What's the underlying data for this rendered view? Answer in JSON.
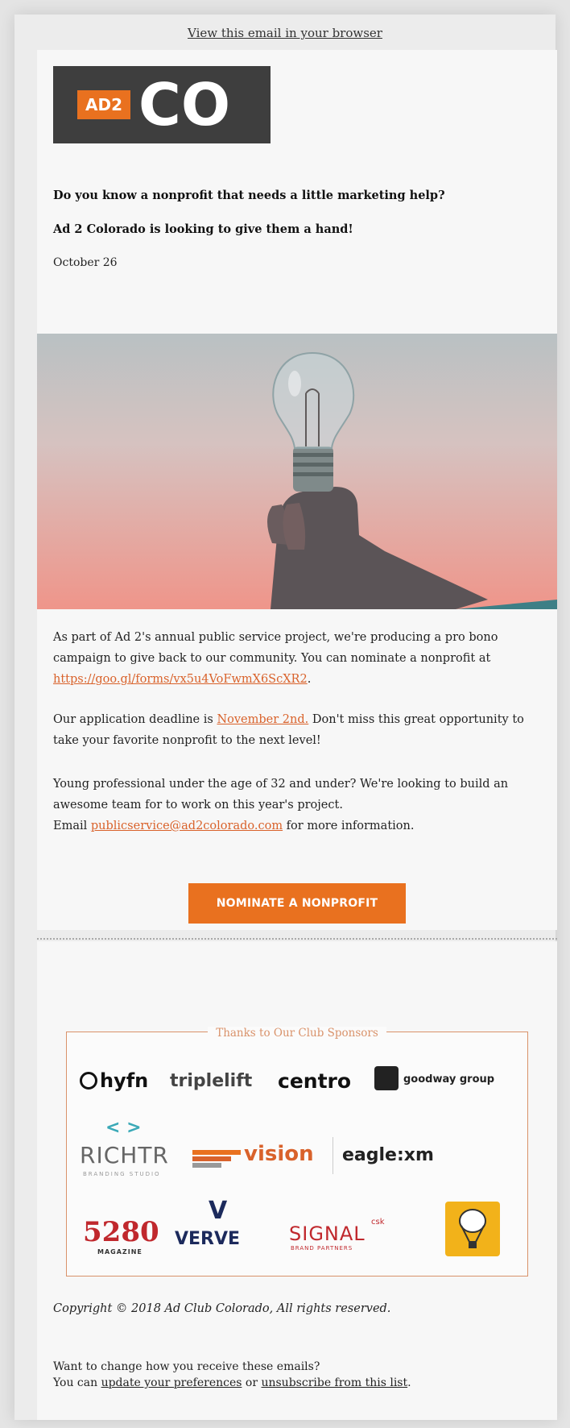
{
  "header": {
    "view_in_browser": "View this email in your browser"
  },
  "logo": {
    "mark": "AD2",
    "letters": "CO"
  },
  "intro": {
    "headline_1": "Do you know a nonprofit that needs a little marketing help?",
    "headline_2": "Ad 2 Colorado is looking to give them a hand!",
    "date": "October 26"
  },
  "hero": {
    "icon": "lightbulb-in-hand"
  },
  "body": {
    "p1_text": "As part of Ad 2's annual public service project, we're producing a pro bono campaign to give back to our community. You can nominate a nonprofit at ",
    "p1_link": "https://goo.gl/forms/vx5u4VoFwmX6ScXR2",
    "p1_end": ".",
    "p2_text": "Our application deadline is ",
    "p2_link": "November 2nd.",
    "p2_end": " Don't miss this great opportunity to take your favorite nonprofit to the next level!",
    "p3_text": "Young professional under the age of 32 and under? We're looking to build an awesome team for to work on this year's project.",
    "p3_email_prefix": "Email ",
    "p3_email": "publicservice@ad2colorado.com",
    "p3_end": " for more information.",
    "cta_label": "NOMINATE A NONPROFIT"
  },
  "sponsors": {
    "title": "Thanks to Our Club Sponsors",
    "row1": [
      "hyfn",
      "triplelift",
      "centro",
      "goodway group"
    ],
    "row2": [
      "RICHTR",
      "vision",
      "eagle:xm"
    ],
    "row3": [
      "5280",
      "VERVE",
      "SIGNAL",
      "csk"
    ],
    "hyfn_sub": "",
    "richter_sub": "BRANDING STUDIO",
    "magazine_sub": "MAGAZINE",
    "signal_sub": "BRAND PARTNERS"
  },
  "footer": {
    "copyright": "Copyright © 2018 Ad Club Colorado, All rights reserved.",
    "prefs_line1": "Want to change how you receive these emails?",
    "prefs_line2_prefix": "You can ",
    "update_link": "update your preferences",
    "prefs_or": " or ",
    "unsubscribe_link": "unsubscribe from this list",
    "prefs_end": "."
  },
  "colors": {
    "accent": "#e9711f",
    "link": "#d9622b",
    "logo_bg": "#3e3e3e"
  }
}
